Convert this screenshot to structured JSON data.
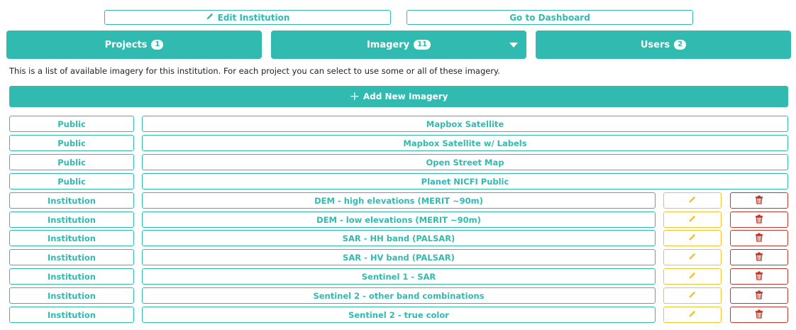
{
  "header": {
    "edit_institution": "Edit Institution",
    "go_to_dashboard": "Go to Dashboard"
  },
  "tabs": [
    {
      "label": "Projects",
      "count": "1"
    },
    {
      "label": "Imagery",
      "count": "11"
    },
    {
      "label": "Users",
      "count": "2"
    }
  ],
  "description": "This is a list of available imagery for this institution. For each project you can select to use some or all of these imagery.",
  "add_button": "Add New Imagery",
  "colors": {
    "accent": "#31bab0",
    "edit": "#f2c230",
    "delete": "#c0392b"
  },
  "icons": {
    "edit": "pencil-icon",
    "delete": "trash-icon",
    "add": "plus-icon",
    "expand": "caret-down-icon"
  },
  "imagery": [
    {
      "visibility": "Public",
      "title": "Mapbox Satellite",
      "editable": false
    },
    {
      "visibility": "Public",
      "title": "Mapbox Satellite w/ Labels",
      "editable": false
    },
    {
      "visibility": "Public",
      "title": "Open Street Map",
      "editable": false
    },
    {
      "visibility": "Public",
      "title": "Planet NICFI Public",
      "editable": false
    },
    {
      "visibility": "Institution",
      "title": "DEM - high elevations (MERIT ~90m)",
      "editable": true
    },
    {
      "visibility": "Institution",
      "title": "DEM - low elevations (MERIT ~90m)",
      "editable": true
    },
    {
      "visibility": "Institution",
      "title": "SAR - HH band (PALSAR)",
      "editable": true
    },
    {
      "visibility": "Institution",
      "title": "SAR - HV band (PALSAR)",
      "editable": true
    },
    {
      "visibility": "Institution",
      "title": "Sentinel 1 - SAR",
      "editable": true
    },
    {
      "visibility": "Institution",
      "title": "Sentinel 2 - other band combinations",
      "editable": true
    },
    {
      "visibility": "Institution",
      "title": "Sentinel 2 - true color",
      "editable": true
    }
  ]
}
